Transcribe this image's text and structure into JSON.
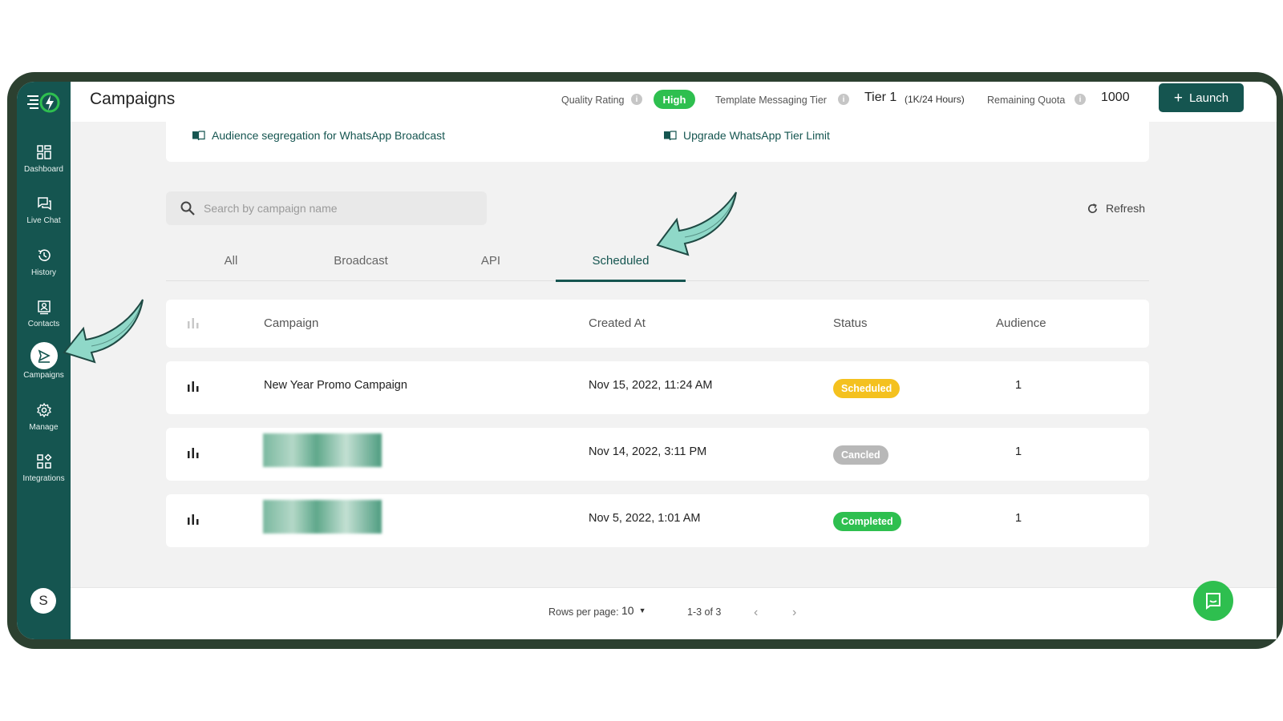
{
  "sidebar": {
    "items": [
      {
        "label": "Dashboard"
      },
      {
        "label": "Live Chat"
      },
      {
        "label": "History"
      },
      {
        "label": "Contacts"
      },
      {
        "label": "Campaigns"
      },
      {
        "label": "Manage"
      },
      {
        "label": "Integrations"
      }
    ],
    "avatar_initial": "S"
  },
  "header": {
    "title": "Campaigns",
    "quality_label": "Quality Rating",
    "quality_value": "High",
    "tier_label": "Template Messaging Tier",
    "tier_value": "Tier 1",
    "tier_sub": "(1K/24 Hours)",
    "quota_label": "Remaining Quota",
    "quota_value": "1000",
    "launch_label": "Launch"
  },
  "resources": {
    "link1": "Audience segregation for WhatsApp Broadcast",
    "link2": "Upgrade WhatsApp Tier Limit"
  },
  "search": {
    "placeholder": "Search by campaign name"
  },
  "refresh_label": "Refresh",
  "tabs": [
    "All",
    "Broadcast",
    "API",
    "Scheduled"
  ],
  "active_tab": "Scheduled",
  "table": {
    "columns": [
      "Campaign",
      "Created At",
      "Status",
      "Audience"
    ],
    "rows": [
      {
        "campaign": "New Year Promo Campaign",
        "created_at": "Nov 15, 2022, 11:24 AM",
        "status": "Scheduled",
        "audience": "1"
      },
      {
        "campaign": "",
        "created_at": "Nov 14, 2022, 3:11 PM",
        "status": "Cancled",
        "audience": "1"
      },
      {
        "campaign": "",
        "created_at": "Nov 5, 2022, 1:01 AM",
        "status": "Completed",
        "audience": "1"
      }
    ]
  },
  "pagination": {
    "rows_per_page_label": "Rows per page:",
    "rows_per_page": "10",
    "range": "1-3 of 3"
  },
  "colors": {
    "brand": "#155550",
    "success": "#2ebf4f",
    "scheduled": "#f4c11f",
    "cancelled": "#b8b8b8",
    "annotation_arrow": "#8fd8c8"
  }
}
